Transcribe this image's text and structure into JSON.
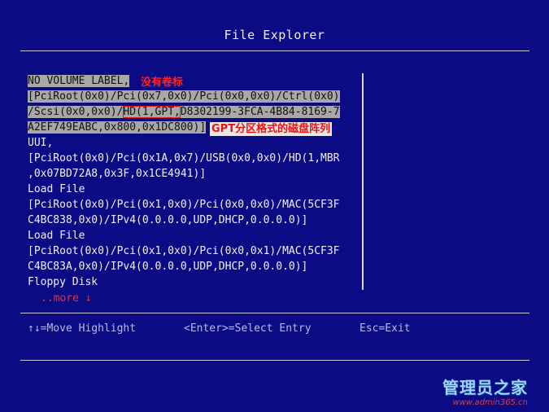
{
  "window": {
    "title": "File Explorer"
  },
  "entries": {
    "selected": {
      "line1": "NO VOLUME LABEL,",
      "line2": "[PciRoot(0x0)/Pci(0x7,0x0)/Pci(0x0,0x0)/Ctrl(0x0)",
      "line3_pre": "/Scsi(0x0,0x0)/",
      "line3_hl": "HD(1,GPT,",
      "line3_post": "D8302199-3FCA-4B84-8169-7",
      "line4": "A2EF749EABC,0x800,0x1DC800)]"
    },
    "items": [
      "UUI,",
      "[PciRoot(0x0)/Pci(0x1A,0x7)/USB(0x0,0x0)/HD(1,MBR",
      ",0x07BD72A8,0x3F,0x1CE4941)]",
      "Load File",
      "[PciRoot(0x0)/Pci(0x1,0x0)/Pci(0x0,0x0)/MAC(5CF3F",
      "C4BC838,0x0)/IPv4(0.0.0.0,UDP,DHCP,0.0.0.0)]",
      "Load File",
      "[PciRoot(0x0)/Pci(0x1,0x0)/Pci(0x0,0x1)/MAC(5CF3F",
      "C4BC83A,0x0)/IPv4(0.0.0.0,UDP,DHCP,0.0.0.0)]",
      "Floppy Disk"
    ],
    "more": "..more ↓"
  },
  "annotations": {
    "no_label": "没有卷标",
    "gpt": "GPT分区格式的磁盘阵列"
  },
  "help": {
    "move": "↑↓=Move Highlight",
    "select": "<Enter>=Select Entry",
    "exit": "Esc=Exit"
  },
  "watermark": {
    "title": "管理员之家",
    "url": "www.admin365.cn"
  },
  "colors": {
    "background": "#0b0b86",
    "selection": "#a8a8a8",
    "annotation": "#ff2222"
  }
}
